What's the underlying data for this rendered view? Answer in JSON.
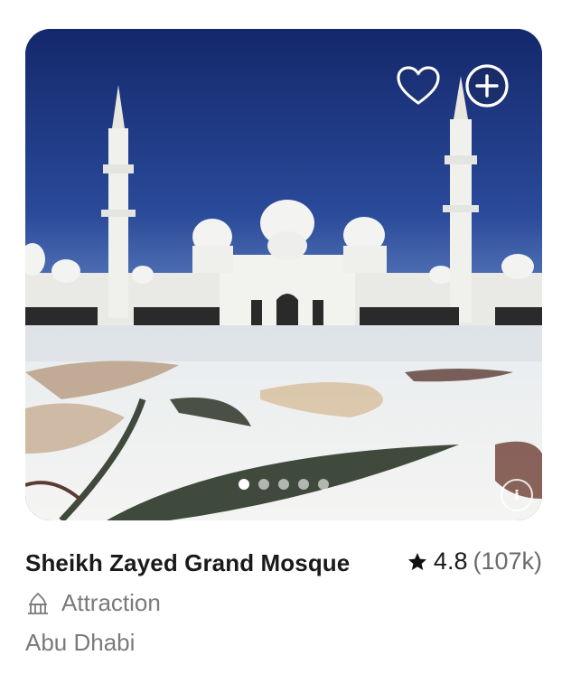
{
  "listing": {
    "title": "Sheikh Zayed Grand Mosque",
    "rating": "4.8",
    "review_count": "(107k)",
    "category": "Attraction",
    "location": "Abu Dhabi"
  },
  "gallery": {
    "image_count": 5,
    "active_index": 0,
    "actions": {
      "favorite_icon": "heart-outline-icon",
      "add_icon": "plus-circle-icon",
      "attribution_icon": "info-circle-icon"
    }
  },
  "colors": {
    "sky": "#1b2f73",
    "title_text": "#1a1a1a",
    "secondary_text": "#7a7a7a"
  }
}
